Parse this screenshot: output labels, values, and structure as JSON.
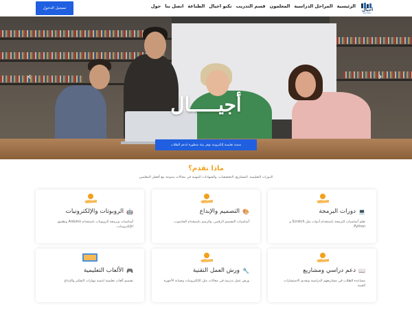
{
  "header": {
    "login_label": "تسجيل الدخول",
    "nav": [
      "الرئيسية",
      "المراحل الدراسية",
      "المعلمون",
      "قسم التدريب",
      "تكنو اجيال",
      "الطباعة",
      "اتصل بنا",
      "حول"
    ],
    "logo_text": "أجيال",
    "logo_sub": "AJYAL"
  },
  "hero": {
    "title": "أجيـــــال",
    "button_label": "منصة تعليمية إلكترونية توفر بيئة متطورة لدعم الطلاب",
    "prev_icon": "chevron-left-icon",
    "next_icon": "chevron-right-icon"
  },
  "section": {
    "title": "ماذا نقدم؟",
    "subtitle": "الدورات التعليمية، المشاريع، التخصصات، والشهادات المهنية في مجالات متنوعة مع أفضل المعلمين"
  },
  "cards": [
    {
      "title": "دورات البرمجة",
      "icon": "laptop-icon",
      "desc": "تعلم أساسيات البرمجة باستخدام أدوات مثل Scratch و Python."
    },
    {
      "title": "التصميم والإبداع",
      "icon": "palette-icon",
      "desc": "أساسيات التصميم الرقمي، والرسم باستخدام الحاسوب."
    },
    {
      "title": "الروبوتات والإلكترونيات",
      "icon": "robot-icon",
      "desc": "أساسيات وبرمجة الروبوتات باستخدام Arduino وتطبيق الإلكترونيات."
    },
    {
      "title": "دعم دراسي ومشاريع",
      "icon": "book-icon",
      "desc": "مساعدة الطلاب في مشاريعهم الدراسية وتقديم الاستشارات الفنية."
    },
    {
      "title": "ورش العمل التقنية",
      "icon": "wrench-icon",
      "desc": "ورش عمل تدريبية في مجالات مثل الإلكترونيات وصيانة الأجهزة."
    },
    {
      "title": "الألعاب التعليمية",
      "icon": "gamepad-icon",
      "desc": "تصميم ألعاب تعليمية لتنمية مهارات التفكير والإبداع."
    }
  ],
  "colors": {
    "primary": "#1f5fe0",
    "accent": "#f2a01e"
  }
}
